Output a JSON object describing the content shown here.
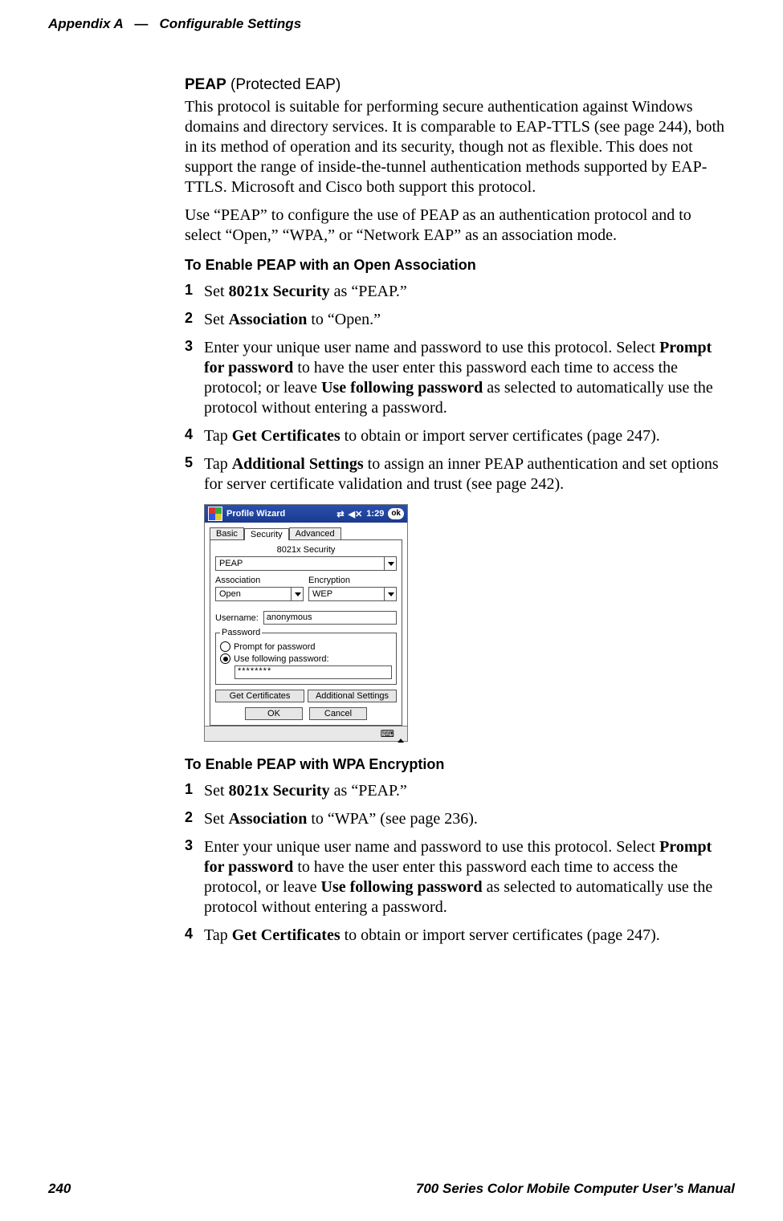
{
  "header": {
    "appendix": "Appendix A",
    "dash": "—",
    "title": "Configurable Settings"
  },
  "peap": {
    "title_bold": "PEAP",
    "title_rest": " (Protected EAP)",
    "p1": "This protocol is suitable for performing secure authentication against Windows domains and directory services. It is comparable to EAP-TTLS (see page 244), both in its method of operation and its security, though not as flexible. This does not support the range of inside-the-tunnel authentication methods supported by EAP-TTLS. Microsoft and Cisco both support this protocol.",
    "p2": "Use “PEAP” to configure the use of PEAP as an authentication protocol and to select “Open,” “WPA,” or “Network EAP” as an association mode."
  },
  "openAssoc": {
    "heading": "To Enable PEAP with an Open Association",
    "s1_a": "Set ",
    "s1_b": "8021x Security",
    "s1_c": " as “PEAP.”",
    "s2_a": "Set ",
    "s2_b": "Association",
    "s2_c": " to “Open.”",
    "s3_a": "Enter your unique user name and password to use this protocol. Select ",
    "s3_b": "Prompt for password",
    "s3_c": " to have the user enter this password each time to access the protocol; or leave ",
    "s3_d": "Use following password",
    "s3_e": " as selected to automatically use the protocol without entering a password.",
    "s4_a": "Tap ",
    "s4_b": "Get Certificates",
    "s4_c": " to obtain or import server certificates (page 247).",
    "s5_a": "Tap ",
    "s5_b": "Additional Settings",
    "s5_c": " to assign an inner PEAP authentication and set options for server certificate validation and trust (see page 242)."
  },
  "shot": {
    "title": "Profile Wizard",
    "time": "1:29",
    "ok": "ok",
    "tab_basic": "Basic",
    "tab_security": "Security",
    "tab_advanced": "Advanced",
    "sec_label": "8021x Security",
    "sec_value": "PEAP",
    "assoc_label": "Association",
    "assoc_value": "Open",
    "enc_label": "Encryption",
    "enc_value": "WEP",
    "user_label": "Username:",
    "user_value": "anonymous",
    "pwd_legend": "Password",
    "pwd_prompt": "Prompt for password",
    "pwd_use": "Use following password:",
    "pwd_value": "********",
    "btn_certs": "Get Certificates",
    "btn_addl": "Additional Settings",
    "btn_ok": "OK",
    "btn_cancel": "Cancel"
  },
  "wpa": {
    "heading": "To Enable PEAP with WPA Encryption",
    "s1_a": "Set ",
    "s1_b": "8021x Security",
    "s1_c": " as “PEAP.”",
    "s2_a": "Set ",
    "s2_b": "Association",
    "s2_c": " to “WPA” (see page 236).",
    "s3_a": "Enter your unique user name and password to use this protocol. Select ",
    "s3_b": "Prompt for password",
    "s3_c": " to have the user enter this password each time to access the protocol, or leave ",
    "s3_d": "Use following password",
    "s3_e": " as selected to automatically use the protocol without entering a password.",
    "s4_a": "Tap ",
    "s4_b": "Get Certificates",
    "s4_c": " to obtain or import server certificates (page 247)."
  },
  "footer": {
    "page": "240",
    "manual": "700 Series Color Mobile Computer User’s Manual"
  },
  "nums": {
    "n1": "1",
    "n2": "2",
    "n3": "3",
    "n4": "4",
    "n5": "5"
  }
}
